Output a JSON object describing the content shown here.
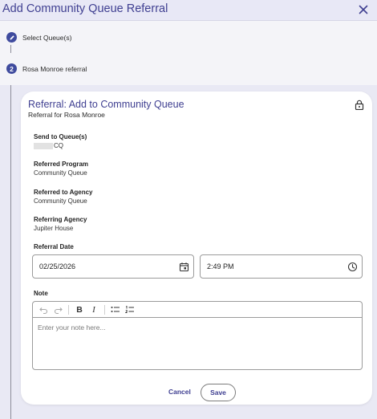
{
  "header": {
    "title": "Add Community Queue Referral"
  },
  "stepper": {
    "step1": {
      "label": "Select Queue(s)"
    },
    "step2": {
      "number": "2",
      "label": "Rosa Monroe referral"
    }
  },
  "card": {
    "title": "Referral: Add to Community Queue",
    "subtitle": "Referral for Rosa Monroe",
    "fields": [
      {
        "label": "Send to Queue(s)",
        "value": "CQ"
      },
      {
        "label": "Referred Program",
        "value": "Community Queue"
      },
      {
        "label": "Referred to Agency",
        "value": "Community Queue"
      },
      {
        "label": "Referring Agency",
        "value": "Jupiter House"
      }
    ],
    "referral_date_label": "Referral Date",
    "date_value": "02/25/2026",
    "time_value": "2:49 PM",
    "note_label": "Note",
    "note_placeholder": "Enter your note here...",
    "toolbar": {
      "bold": "B",
      "italic": "I"
    },
    "cancel_label": "Cancel",
    "save_label": "Save"
  },
  "colors": {
    "accent": "#3f3f91",
    "step_circle": "#3f4b9e"
  }
}
